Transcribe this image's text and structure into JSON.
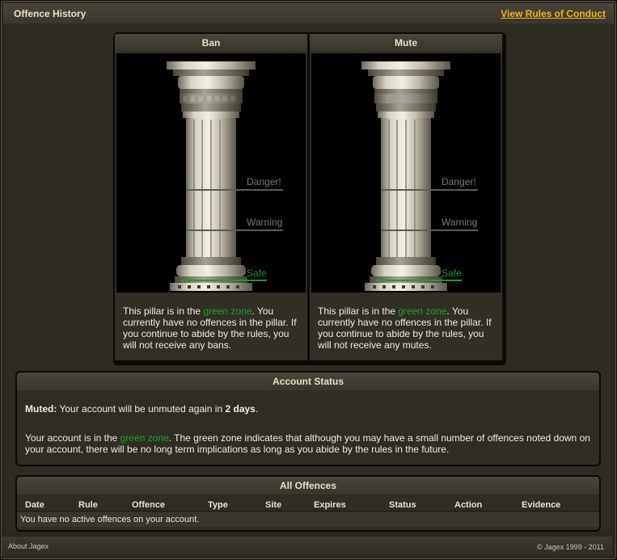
{
  "header": {
    "title": "Offence History",
    "rules_link": "View Rules of Conduct"
  },
  "pillars": {
    "ban": {
      "title": "Ban",
      "labels": {
        "danger": "Danger!",
        "warning": "Warning",
        "safe": "Safe"
      },
      "desc_pre": "This pillar is in the ",
      "desc_zone": "green zone",
      "desc_post": ". You currently have no offences in the pillar. If you continue to abide by the rules, you will not receive any bans."
    },
    "mute": {
      "title": "Mute",
      "labels": {
        "danger": "Danger!",
        "warning": "Warning",
        "safe": "Safe"
      },
      "desc_pre": "This pillar is in the ",
      "desc_zone": "green zone",
      "desc_post": ". You currently have no offences in the pillar. If you continue to abide by the rules, you will not receive any mutes."
    }
  },
  "account_status": {
    "title": "Account Status",
    "muted_label": "Muted:",
    "muted_text": " Your account will be unmuted again in ",
    "muted_days": "2 days",
    "muted_end": ".",
    "zone_pre": "Your account is in the ",
    "zone": "green zone",
    "zone_post": ". The green zone indicates that although you may have a small number of offences noted down on your account, there will be no long term implications as long as you abide by the rules in the future."
  },
  "all_offences": {
    "title": "All Offences",
    "columns": [
      "Date",
      "Rule",
      "Offence",
      "Type",
      "Site",
      "Expires",
      "Status",
      "Action",
      "Evidence"
    ],
    "empty_text": "You have no active offences on your account."
  },
  "footer": {
    "about": "About Jagex",
    "copyright": "© Jagex 1999 - 2011"
  },
  "colors": {
    "accent_link": "#f3b41a",
    "green_zone": "#1f9e2a"
  }
}
